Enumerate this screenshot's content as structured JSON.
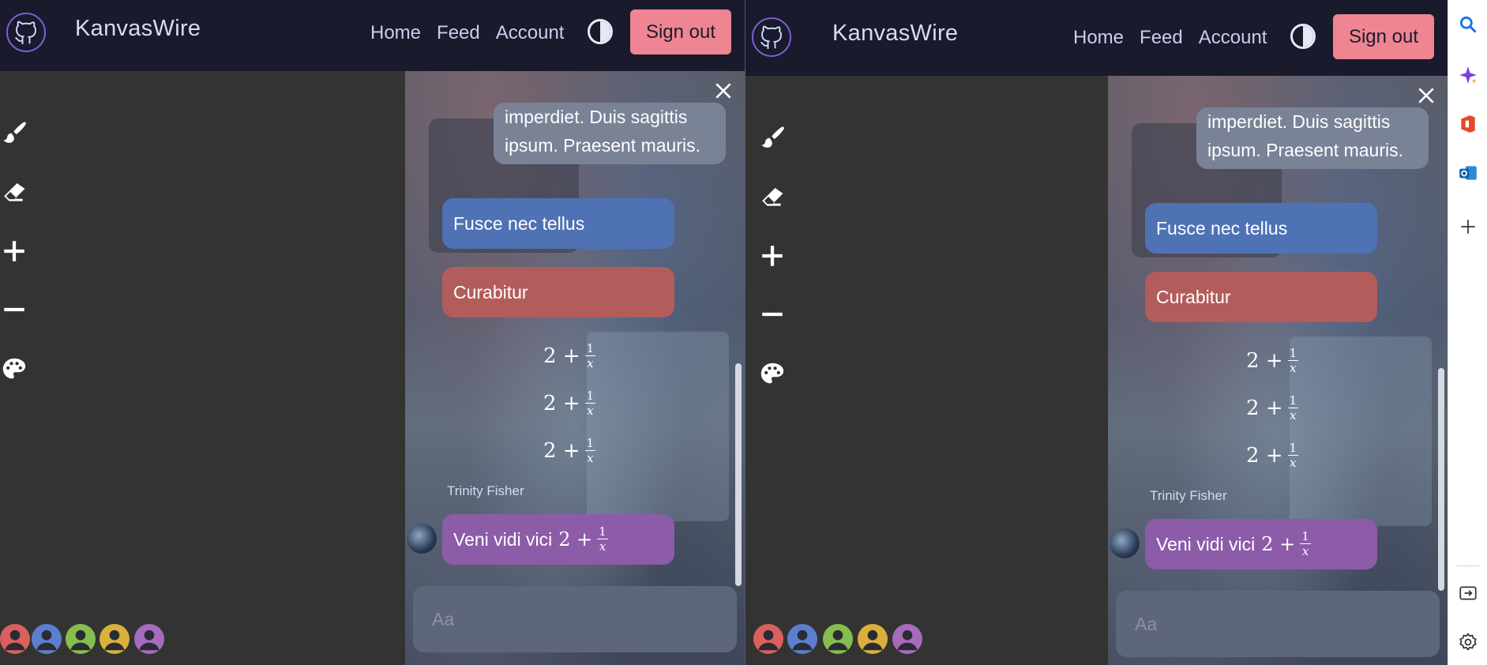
{
  "app": {
    "brand": "KanvasWire",
    "nav": {
      "home": "Home",
      "feed": "Feed",
      "account": "Account"
    },
    "sign_out": "Sign out"
  },
  "tools": [
    "brush-icon",
    "eraser-icon",
    "zoom-in-icon",
    "zoom-out-icon",
    "palette-icon"
  ],
  "users": [
    {
      "icon": "user-icon",
      "color": "#d9605e"
    },
    {
      "icon": "user-icon",
      "color": "#5b7fcf"
    },
    {
      "icon": "user-icon",
      "color": "#86bd4f"
    },
    {
      "icon": "user-icon",
      "color": "#d9b13a"
    },
    {
      "icon": "user-icon",
      "color": "#a66bbd"
    }
  ],
  "chat": {
    "messages": {
      "gray_line1": "imperdiet. Duis sagittis",
      "gray_line2": "ipsum. Praesent mauris.",
      "blue": "Fusce nec tellus",
      "red": "Curabitur",
      "math_base": "2 +",
      "math_num": "1",
      "math_den": "x",
      "sender": "Trinity Fisher",
      "purple": "Veni vidi vici"
    },
    "compose_placeholder": "Aa"
  },
  "colors": {
    "navbar": "#191a2b",
    "sign_out": "#ef8593",
    "canvas": "#333432",
    "bubble_blue": "#4f72b5",
    "bubble_red": "#b35c5c",
    "bubble_purple": "#8c5ca8",
    "bubble_gray": "#7a8296"
  },
  "edge_sidebar": [
    "search-icon",
    "copilot-icon",
    "office-icon",
    "outlook-icon",
    "add-icon",
    "exit-sidebar-icon",
    "settings-icon"
  ]
}
